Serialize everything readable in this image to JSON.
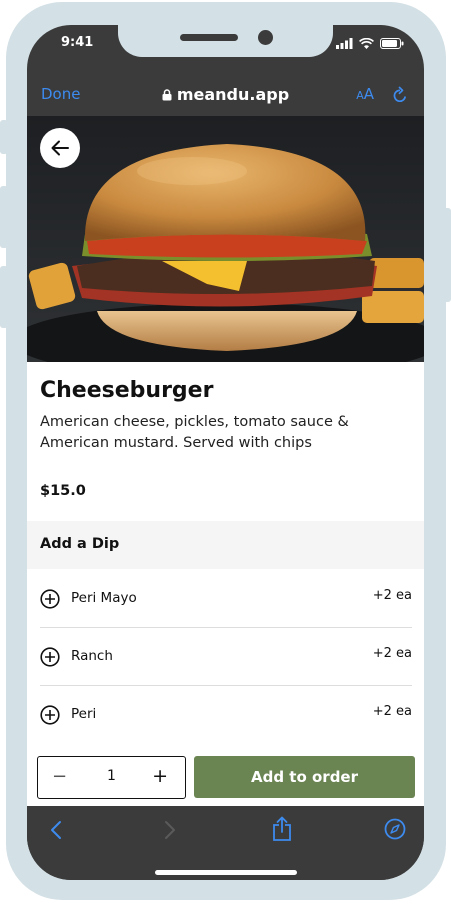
{
  "status_bar": {
    "time": "9:41"
  },
  "browser": {
    "done_label": "Done",
    "url": "meandu.app",
    "text_size_label": "AA"
  },
  "product": {
    "name": "Cheeseburger",
    "description": "American cheese, pickles, tomato sauce & American mustard. Served with chips",
    "price": "$15.0"
  },
  "dips": {
    "title": "Add a Dip",
    "options": [
      {
        "label": "Peri Mayo",
        "price": "+2 ea"
      },
      {
        "label": "Ranch",
        "price": "+2 ea"
      },
      {
        "label": "Peri",
        "price": "+2 ea"
      }
    ]
  },
  "order": {
    "minus": "−",
    "quantity": "1",
    "plus": "+",
    "add_label": "Add to order"
  },
  "icons": {
    "back": "arrow-left-icon",
    "lock": "lock-icon",
    "reload": "reload-icon",
    "add_option": "plus-circle-icon",
    "nav_back": "chevron-left-icon",
    "nav_forward": "chevron-right-icon",
    "share": "share-icon",
    "compass": "compass-icon"
  },
  "colors": {
    "accent_blue": "#3d8bef",
    "add_button": "#6a8452",
    "frame": "#d3e0e5",
    "browser_chrome": "#3b3b3b"
  }
}
